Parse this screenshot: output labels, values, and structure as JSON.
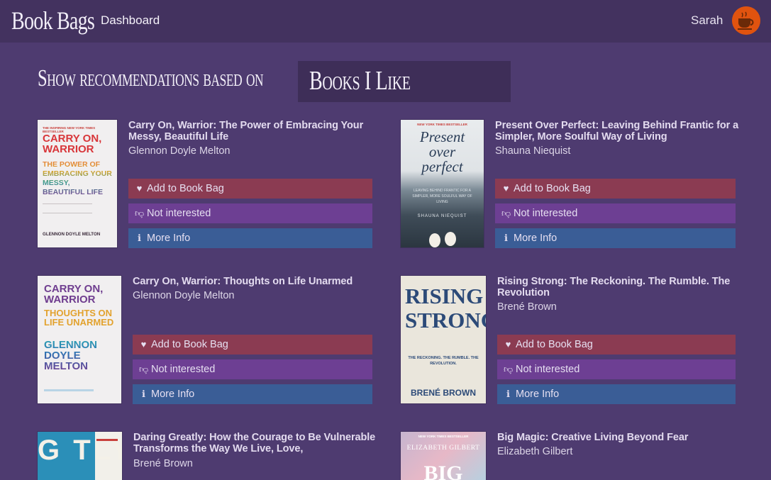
{
  "header": {
    "brand": "Book Bags",
    "nav_dashboard": "Dashboard",
    "user_name": "Sarah"
  },
  "recommendations": {
    "label": "Show recommendations based on",
    "selected": "Books I Like"
  },
  "buttons": {
    "add": "Add to Book Bag",
    "not_interested": "Not interested",
    "more_info": "More Info"
  },
  "books": [
    {
      "title": "Carry On, Warrior: The Power of Embracing Your Messy, Beautiful Life",
      "author": "Glennon Doyle Melton",
      "cover_top": "THE INSPIRING NEW YORK TIMES BESTSELLER",
      "cover_main": "CARRY ON, WARRIOR",
      "cover_sub": "THE POWER OF EMBRACING YOUR MESSY, BEAUTIFUL LIFE",
      "cover_author": "GLENNON DOYLE MELTON"
    },
    {
      "title": "Present Over Perfect: Leaving Behind Frantic for a Simpler, More Soulful Way of Living",
      "author": "Shauna Niequist",
      "cover_top": "NEW YORK TIMES BESTSELLER",
      "cover_main": "Present over perfect",
      "cover_sub": "LEAVING BEHIND FRANTIC FOR A SIMPLER, MORE SOULFUL WAY OF LIVING",
      "cover_author": "SHAUNA NIEQUIST"
    },
    {
      "title": "Carry On, Warrior: Thoughts on Life Unarmed",
      "author": "Glennon Doyle Melton",
      "cover_main": "CARRY ON, WARRIOR",
      "cover_sub": "THOUGHTS ON LIFE UNARMED",
      "cover_author": "GLENNON DOYLE MELTON"
    },
    {
      "title": "Rising Strong: The Reckoning. The Rumble. The Revolution",
      "author": "Brené Brown",
      "cover_main": "RISING STRONG",
      "cover_sub": "THE RECKONING. THE RUMBLE. THE REVOLUTION.",
      "cover_author": "BRENÉ BROWN"
    },
    {
      "title": "Daring Greatly: How the Courage to Be Vulnerable Transforms the Way We Live, Love,",
      "author": "Brené Brown",
      "cover_main": "G TLY"
    },
    {
      "title": "Big Magic: Creative Living Beyond Fear",
      "author": "Elizabeth Gilbert",
      "cover_top": "NEW YORK TIMES BESTSELLER",
      "cover_main": "ELIZABETH GILBERT",
      "cover_sub": "BIG"
    }
  ],
  "colors": {
    "page_bg": "#4e3b70",
    "topbar_bg": "#43325f",
    "add_button": "#8b3b52",
    "not_interested_button": "#6d3f93",
    "more_info_button": "#3a5d96",
    "avatar_bg": "#e0530f"
  },
  "icons": {
    "add": "heart-icon",
    "not_interested": "thumbs-down-icon",
    "more_info": "info-circle-icon",
    "avatar": "coffee-cup-icon"
  }
}
